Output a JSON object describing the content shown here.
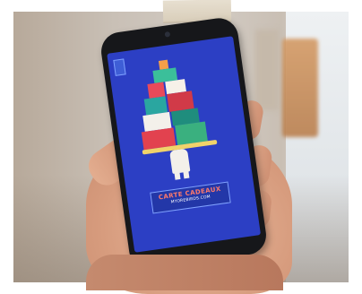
{
  "photo": {
    "scene": "hand holding smartphone showing gift card app"
  },
  "screen": {
    "banner_title": "CARTE CADEAUX",
    "banner_subtitle": "MYOREBIRDS.COM"
  },
  "colors": {
    "screen_bg": "#2c3fc4",
    "banner_text": "#ff7a6b"
  }
}
